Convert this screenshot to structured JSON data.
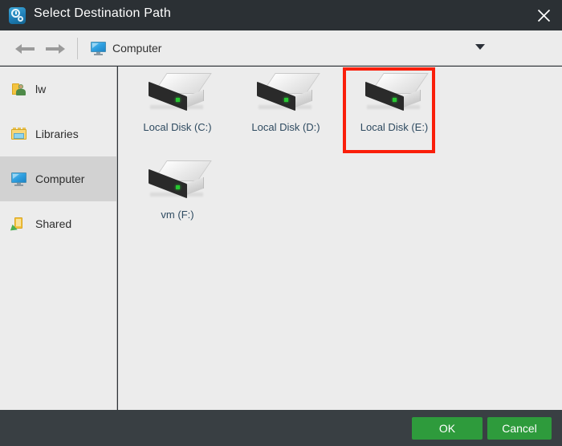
{
  "window": {
    "title": "Select Destination Path",
    "app_icon": "clock-gear-icon",
    "close_icon": "close-icon"
  },
  "toolbar": {
    "back_icon": "arrow-left-icon",
    "forward_icon": "arrow-right-icon",
    "breadcrumb_icon": "monitor-icon",
    "breadcrumb_label": "Computer",
    "dropdown_icon": "chevron-down-icon",
    "new_folder_icon": "plus-icon",
    "view_list_icon": "list-view-icon"
  },
  "sidebar": {
    "items": [
      {
        "label": "lw",
        "icon": "user-folder-icon",
        "active": false
      },
      {
        "label": "Libraries",
        "icon": "libraries-icon",
        "active": false
      },
      {
        "label": "Computer",
        "icon": "monitor-icon",
        "active": true
      },
      {
        "label": "Shared",
        "icon": "shared-folder-icon",
        "active": false
      }
    ]
  },
  "content": {
    "drives": [
      {
        "label": "Local Disk (C:)",
        "icon": "hard-drive-icon",
        "selected": false
      },
      {
        "label": "Local Disk (D:)",
        "icon": "hard-drive-icon",
        "selected": false
      },
      {
        "label": "Local Disk (E:)",
        "icon": "hard-drive-icon",
        "selected": true
      },
      {
        "label": "vm (F:)",
        "icon": "hard-drive-icon",
        "selected": false
      }
    ],
    "highlight_color": "#fa1e0a"
  },
  "footer": {
    "ok_label": "OK",
    "cancel_label": "Cancel",
    "button_color": "#2e9b3c"
  }
}
